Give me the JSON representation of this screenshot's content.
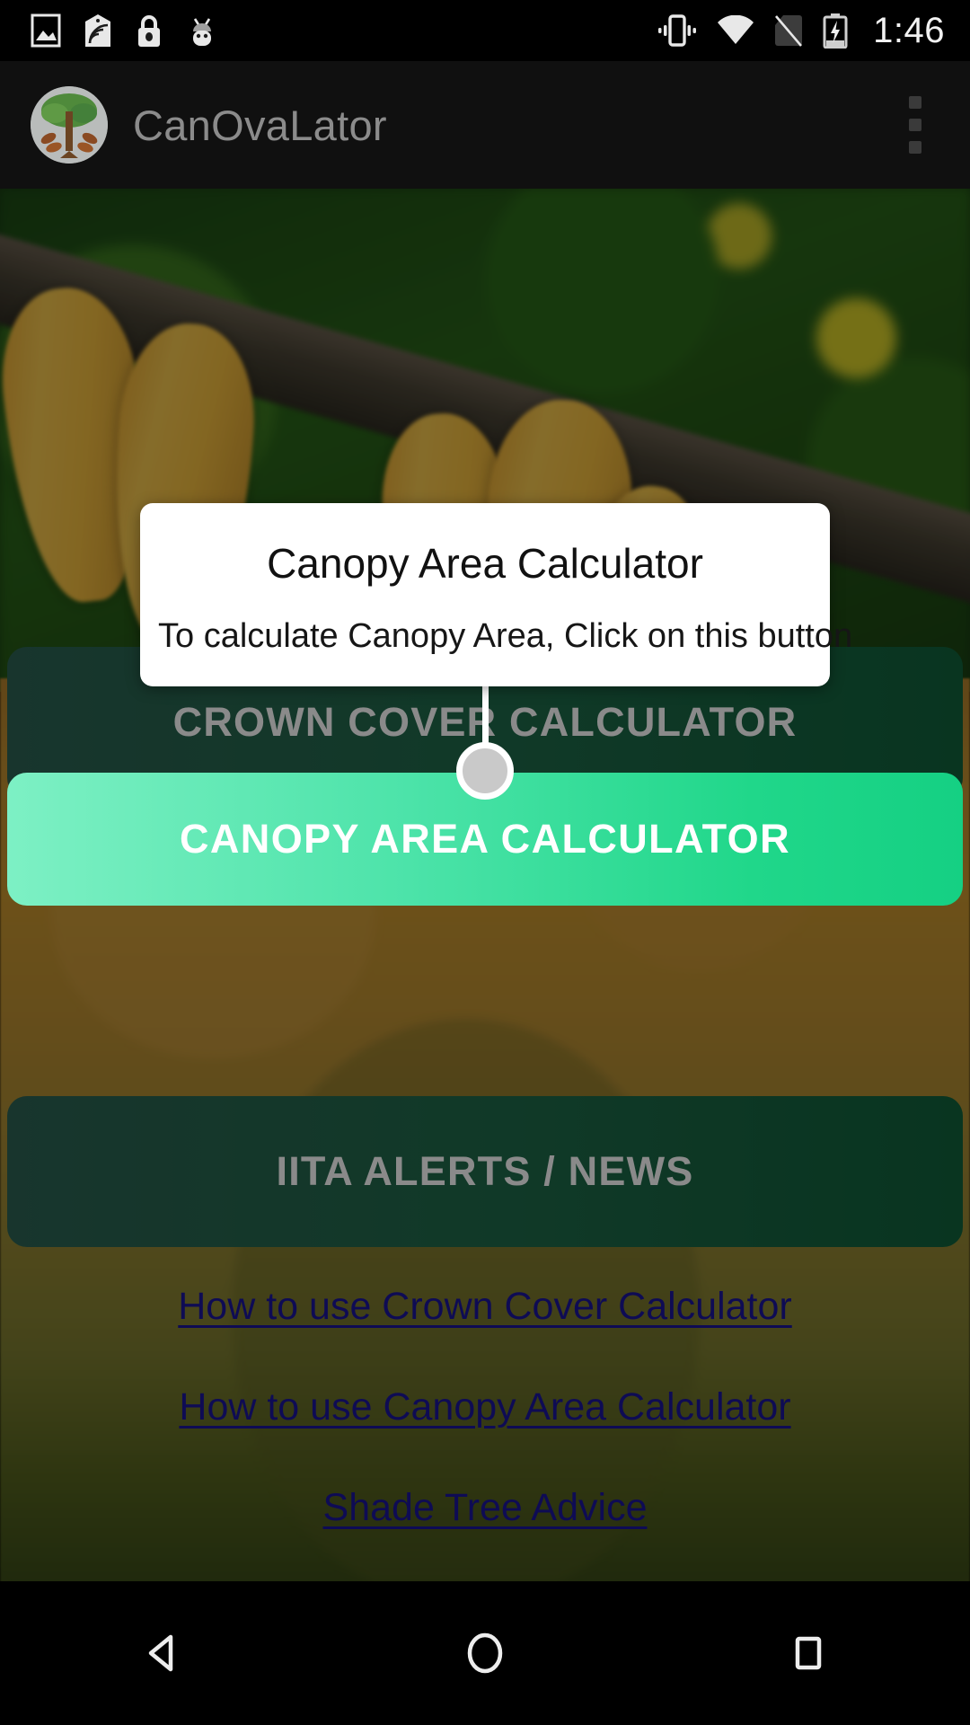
{
  "status_bar": {
    "time": "1:46",
    "icons_left": [
      "image-icon",
      "nfc-icon",
      "lock-icon",
      "android-icon"
    ],
    "icons_right": [
      "vibrate-icon",
      "wifi-icon",
      "no-sim-icon",
      "battery-charging-icon"
    ]
  },
  "app_bar": {
    "title": "CanOvaLator",
    "logo_icon": "cocoa-tree-logo",
    "overflow_icon": "overflow-menu-icon"
  },
  "hero": {
    "image_alt": "cocoa-pods-on-branch"
  },
  "buttons": {
    "crown_cover": "CROWN COVER CALCULATOR",
    "canopy_area": "CANOPY AREA CALCULATOR",
    "iita_alerts": "IITA ALERTS / NEWS"
  },
  "links": [
    {
      "label": "How to use Crown Cover Calculator"
    },
    {
      "label": "How to use Canopy Area Calculator"
    },
    {
      "label": "Shade Tree Advice"
    }
  ],
  "showcase": {
    "title": "Canopy Area Calculator",
    "body": "To calculate Canopy Area, Click on this button"
  },
  "nav_bar": {
    "back": "back-icon",
    "home": "home-icon",
    "recents": "recents-icon"
  },
  "colors": {
    "accent_green_light": "#7DF0C4",
    "accent_green_dark": "#15D083",
    "button_green": "#11623C",
    "link_blue": "#1B169C",
    "appbar_bg": "#101010"
  }
}
